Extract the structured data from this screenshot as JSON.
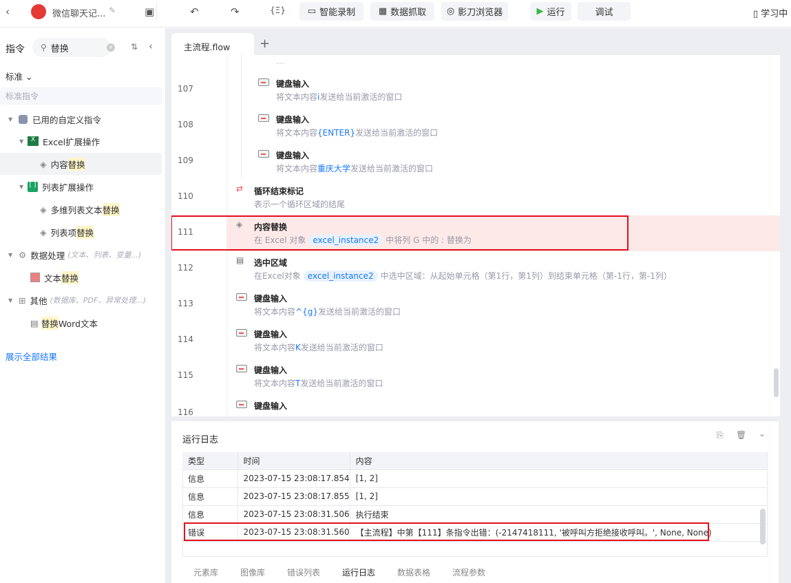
{
  "topbar": {
    "title": "微信聊天记...",
    "record": "智能录制",
    "scrape": "数据抓取",
    "browser": "影刀浏览器",
    "run": "运行",
    "debug": "调试",
    "learn": "学习中"
  },
  "sidebar": {
    "header": "指令",
    "search_value": "替换",
    "category": "标准",
    "section": "标准指令",
    "custom": "已用的自定义指令",
    "excel_ext": "Excel扩展操作",
    "content_replace_a": "内容",
    "content_replace_b": "替换",
    "list_ext": "列表扩展操作",
    "multi_a": "多维列表文本",
    "multi_b": "替换",
    "listitem_a": "列表项",
    "listitem_b": "替换",
    "data_proc": "数据处理",
    "data_note": "(文本、列表、变量...)",
    "text_a": "文本",
    "text_b": "替换",
    "other": "其他",
    "other_note": "(数据库、PDF、异常处理...)",
    "word_a": "替换",
    "word_b": "Word文本",
    "show_all": "展示全部结果"
  },
  "tab": {
    "label": "主流程.flow"
  },
  "flow": {
    "r107": {
      "n": "107",
      "t": "键盘输入",
      "p": "将文本内容",
      "v": "i",
      "s": "发送给当前激活的窗口"
    },
    "r108": {
      "n": "108",
      "t": "键盘输入",
      "p": "将文本内容",
      "v": "{ENTER}",
      "s": "发送给当前激活的窗口"
    },
    "r109": {
      "n": "109",
      "t": "键盘输入",
      "p": "将文本内容",
      "v": "重庆大学",
      "s": "发送给当前激活的窗口"
    },
    "r110": {
      "n": "110",
      "t": "循环结束标记",
      "d": "表示一个循环区域的结尾"
    },
    "r111": {
      "n": "111",
      "t": "内容替换",
      "p": "在 Excel 对象",
      "v": "excel_instance2",
      "s": "中将列 G 中的 :  替换为"
    },
    "r112": {
      "n": "112",
      "t": "选中区域",
      "p": "在Excel对象",
      "v": "excel_instance2",
      "s": "中选中区域：从起始单元格（第1行，第1列）到结束单元格（第-1行，第-1列）"
    },
    "r113": {
      "n": "113",
      "t": "键盘输入",
      "p": "将文本内容",
      "v": "^{g}",
      "s": "发送给当前激活的窗口"
    },
    "r114": {
      "n": "114",
      "t": "键盘输入",
      "p": "将文本内容",
      "v": "K",
      "s": "发送给当前激活的窗口"
    },
    "r115": {
      "n": "115",
      "t": "键盘输入",
      "p": "将文本内容",
      "v": "T",
      "s": "发送给当前激活的窗口"
    },
    "r116": {
      "n": "116",
      "t": "键盘输入"
    }
  },
  "log": {
    "title": "运行日志",
    "cols": [
      "类型",
      "时间",
      "内容"
    ],
    "rows": [
      [
        "信息",
        "2023-07-15 23:08:17.854",
        "[1, 2]"
      ],
      [
        "信息",
        "2023-07-15 23:08:17.855",
        "[1, 2]"
      ],
      [
        "信息",
        "2023-07-15 23:08:31.506",
        "执行结束"
      ],
      [
        "错误",
        "2023-07-15 23:08:31.560",
        "【主流程】中第【111】条指令出错：(-2147418111, '被呼叫方拒绝接收呼叫。', None, None)"
      ]
    ],
    "tabs": [
      "元素库",
      "图像库",
      "错误列表",
      "运行日志",
      "数据表格",
      "流程参数"
    ]
  }
}
